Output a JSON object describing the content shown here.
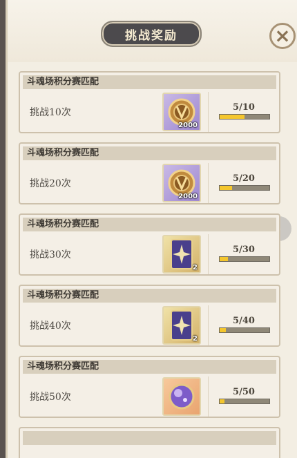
{
  "header": {
    "title": "挑战奖励",
    "close_label": "×"
  },
  "side_arrow": "›",
  "rewards": [
    {
      "category": "斗魂场积分赛匹配",
      "task": "挑战10次",
      "item_icon": "gold-emblem-icon",
      "quantity": "2000",
      "progress_text": "5/10",
      "progress": 0.5
    },
    {
      "category": "斗魂场积分赛匹配",
      "task": "挑战20次",
      "item_icon": "gold-emblem-icon",
      "quantity": "2000",
      "progress_text": "5/20",
      "progress": 0.25
    },
    {
      "category": "斗魂场积分赛匹配",
      "task": "挑战30次",
      "item_icon": "star-card-icon",
      "quantity": "2",
      "progress_text": "5/30",
      "progress": 0.1667
    },
    {
      "category": "斗魂场积分赛匹配",
      "task": "挑战40次",
      "item_icon": "star-card-icon",
      "quantity": "2",
      "progress_text": "5/40",
      "progress": 0.125
    },
    {
      "category": "斗魂场积分赛匹配",
      "task": "挑战50次",
      "item_icon": "purple-orb-icon",
      "quantity": "",
      "progress_text": "5/50",
      "progress": 0.1
    }
  ]
}
